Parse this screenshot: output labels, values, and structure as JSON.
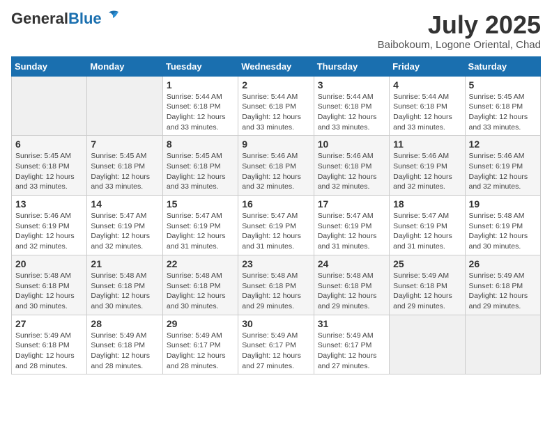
{
  "header": {
    "logo_general": "General",
    "logo_blue": "Blue",
    "month": "July 2025",
    "location": "Baibokoum, Logone Oriental, Chad"
  },
  "days_of_week": [
    "Sunday",
    "Monday",
    "Tuesday",
    "Wednesday",
    "Thursday",
    "Friday",
    "Saturday"
  ],
  "weeks": [
    [
      {
        "day": "",
        "info": ""
      },
      {
        "day": "",
        "info": ""
      },
      {
        "day": "1",
        "info": "Sunrise: 5:44 AM\nSunset: 6:18 PM\nDaylight: 12 hours and 33 minutes."
      },
      {
        "day": "2",
        "info": "Sunrise: 5:44 AM\nSunset: 6:18 PM\nDaylight: 12 hours and 33 minutes."
      },
      {
        "day": "3",
        "info": "Sunrise: 5:44 AM\nSunset: 6:18 PM\nDaylight: 12 hours and 33 minutes."
      },
      {
        "day": "4",
        "info": "Sunrise: 5:44 AM\nSunset: 6:18 PM\nDaylight: 12 hours and 33 minutes."
      },
      {
        "day": "5",
        "info": "Sunrise: 5:45 AM\nSunset: 6:18 PM\nDaylight: 12 hours and 33 minutes."
      }
    ],
    [
      {
        "day": "6",
        "info": "Sunrise: 5:45 AM\nSunset: 6:18 PM\nDaylight: 12 hours and 33 minutes."
      },
      {
        "day": "7",
        "info": "Sunrise: 5:45 AM\nSunset: 6:18 PM\nDaylight: 12 hours and 33 minutes."
      },
      {
        "day": "8",
        "info": "Sunrise: 5:45 AM\nSunset: 6:18 PM\nDaylight: 12 hours and 33 minutes."
      },
      {
        "day": "9",
        "info": "Sunrise: 5:46 AM\nSunset: 6:18 PM\nDaylight: 12 hours and 32 minutes."
      },
      {
        "day": "10",
        "info": "Sunrise: 5:46 AM\nSunset: 6:18 PM\nDaylight: 12 hours and 32 minutes."
      },
      {
        "day": "11",
        "info": "Sunrise: 5:46 AM\nSunset: 6:19 PM\nDaylight: 12 hours and 32 minutes."
      },
      {
        "day": "12",
        "info": "Sunrise: 5:46 AM\nSunset: 6:19 PM\nDaylight: 12 hours and 32 minutes."
      }
    ],
    [
      {
        "day": "13",
        "info": "Sunrise: 5:46 AM\nSunset: 6:19 PM\nDaylight: 12 hours and 32 minutes."
      },
      {
        "day": "14",
        "info": "Sunrise: 5:47 AM\nSunset: 6:19 PM\nDaylight: 12 hours and 32 minutes."
      },
      {
        "day": "15",
        "info": "Sunrise: 5:47 AM\nSunset: 6:19 PM\nDaylight: 12 hours and 31 minutes."
      },
      {
        "day": "16",
        "info": "Sunrise: 5:47 AM\nSunset: 6:19 PM\nDaylight: 12 hours and 31 minutes."
      },
      {
        "day": "17",
        "info": "Sunrise: 5:47 AM\nSunset: 6:19 PM\nDaylight: 12 hours and 31 minutes."
      },
      {
        "day": "18",
        "info": "Sunrise: 5:47 AM\nSunset: 6:19 PM\nDaylight: 12 hours and 31 minutes."
      },
      {
        "day": "19",
        "info": "Sunrise: 5:48 AM\nSunset: 6:19 PM\nDaylight: 12 hours and 30 minutes."
      }
    ],
    [
      {
        "day": "20",
        "info": "Sunrise: 5:48 AM\nSunset: 6:18 PM\nDaylight: 12 hours and 30 minutes."
      },
      {
        "day": "21",
        "info": "Sunrise: 5:48 AM\nSunset: 6:18 PM\nDaylight: 12 hours and 30 minutes."
      },
      {
        "day": "22",
        "info": "Sunrise: 5:48 AM\nSunset: 6:18 PM\nDaylight: 12 hours and 30 minutes."
      },
      {
        "day": "23",
        "info": "Sunrise: 5:48 AM\nSunset: 6:18 PM\nDaylight: 12 hours and 29 minutes."
      },
      {
        "day": "24",
        "info": "Sunrise: 5:48 AM\nSunset: 6:18 PM\nDaylight: 12 hours and 29 minutes."
      },
      {
        "day": "25",
        "info": "Sunrise: 5:49 AM\nSunset: 6:18 PM\nDaylight: 12 hours and 29 minutes."
      },
      {
        "day": "26",
        "info": "Sunrise: 5:49 AM\nSunset: 6:18 PM\nDaylight: 12 hours and 29 minutes."
      }
    ],
    [
      {
        "day": "27",
        "info": "Sunrise: 5:49 AM\nSunset: 6:18 PM\nDaylight: 12 hours and 28 minutes."
      },
      {
        "day": "28",
        "info": "Sunrise: 5:49 AM\nSunset: 6:18 PM\nDaylight: 12 hours and 28 minutes."
      },
      {
        "day": "29",
        "info": "Sunrise: 5:49 AM\nSunset: 6:17 PM\nDaylight: 12 hours and 28 minutes."
      },
      {
        "day": "30",
        "info": "Sunrise: 5:49 AM\nSunset: 6:17 PM\nDaylight: 12 hours and 27 minutes."
      },
      {
        "day": "31",
        "info": "Sunrise: 5:49 AM\nSunset: 6:17 PM\nDaylight: 12 hours and 27 minutes."
      },
      {
        "day": "",
        "info": ""
      },
      {
        "day": "",
        "info": ""
      }
    ]
  ]
}
